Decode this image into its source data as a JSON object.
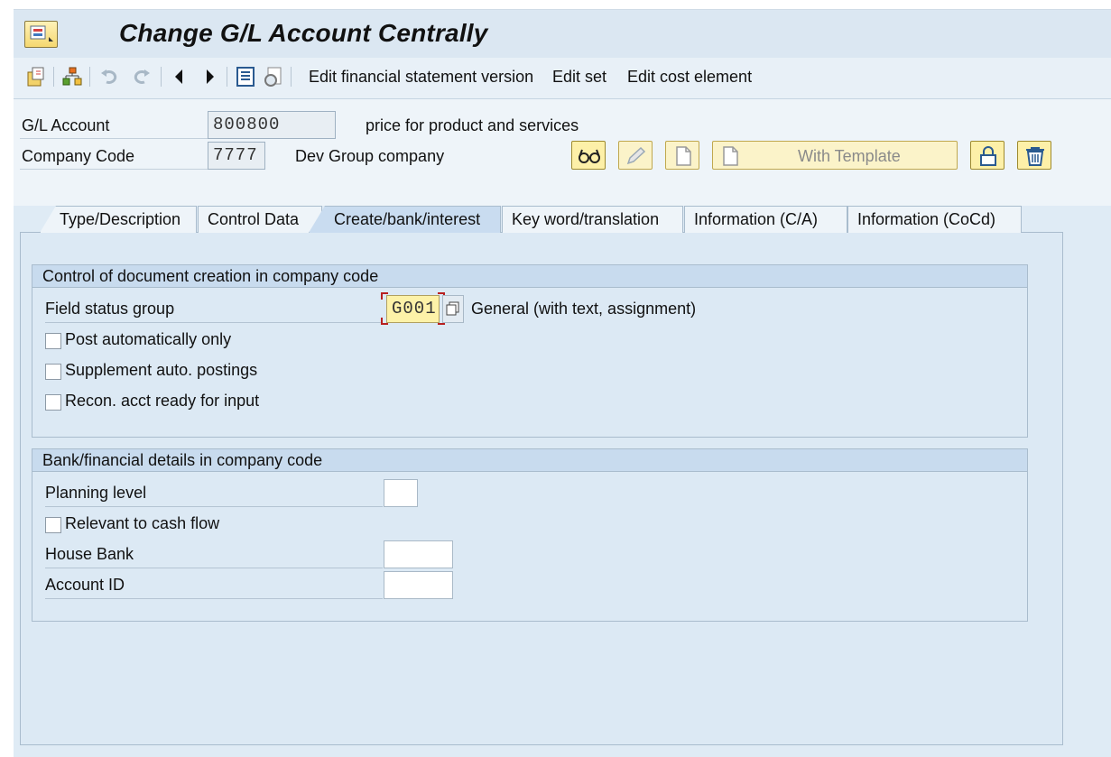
{
  "window": {
    "title": "Change G/L Account Centrally"
  },
  "toolbar": {
    "icons": [
      "change-mode-icon",
      "hierarchy-icon",
      "undo-icon",
      "redo-icon",
      "previous-icon",
      "next-icon",
      "where-used-icon",
      "display-icon"
    ],
    "links": [
      "Edit financial statement version",
      "Edit set",
      "Edit cost element"
    ]
  },
  "header": {
    "gl_account_label": "G/L Account",
    "gl_account_value": "800800",
    "gl_account_desc": "price for product and services",
    "company_code_label": "Company Code",
    "company_code_value": "7777",
    "company_code_desc": "Dev Group company",
    "with_template_label": "With Template"
  },
  "tabs": [
    {
      "label": "Type/Description",
      "active": false
    },
    {
      "label": "Control Data",
      "active": false
    },
    {
      "label": "Create/bank/interest",
      "active": true
    },
    {
      "label": "Key word/translation",
      "active": false
    },
    {
      "label": "Information (C/A)",
      "active": false
    },
    {
      "label": "Information (CoCd)",
      "active": false
    }
  ],
  "group_doc_creation": {
    "title": "Control of document creation in company code",
    "field_status_group_label": "Field status group",
    "field_status_group_value": "G001",
    "field_status_group_desc": "General (with text, assignment)",
    "post_auto_label": "Post automatically only",
    "supplement_label": "Supplement auto. postings",
    "recon_label": "Recon. acct ready for input"
  },
  "group_bank": {
    "title": "Bank/financial details in company code",
    "planning_level_label": "Planning level",
    "cash_flow_label": "Relevant to cash flow",
    "house_bank_label": "House Bank",
    "account_id_label": "Account ID"
  },
  "colors": {
    "accent": "#f5d870",
    "panel": "#dce9f4",
    "tab_active": "#c9dcf0"
  }
}
